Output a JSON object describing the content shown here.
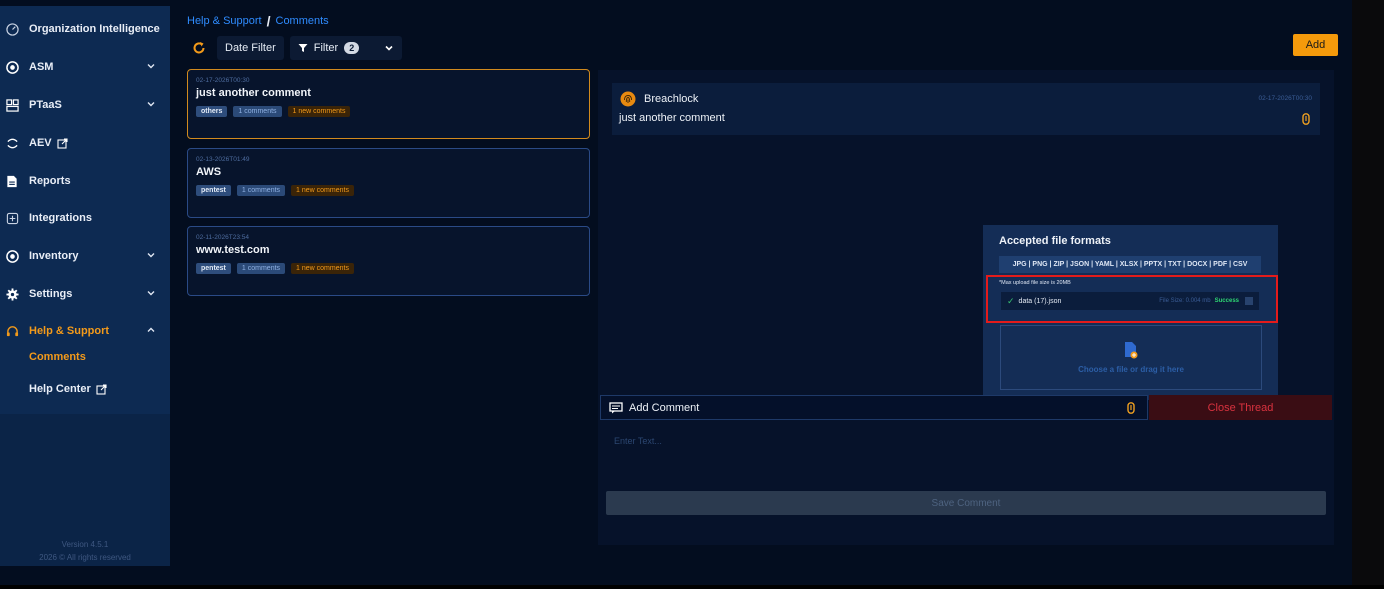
{
  "sidebar": {
    "items": [
      {
        "label": "Organization Intelligence",
        "icon": "gauge-icon"
      },
      {
        "label": "ASM",
        "icon": "target-icon"
      },
      {
        "label": "PTaaS",
        "icon": "dashboard-icon"
      },
      {
        "label": "AEV",
        "icon": "loop-icon"
      },
      {
        "label": "Reports",
        "icon": "document-icon"
      },
      {
        "label": "Integrations",
        "icon": "plug-icon"
      },
      {
        "label": "Inventory",
        "icon": "target-icon"
      },
      {
        "label": "Settings",
        "icon": "gear-icon"
      },
      {
        "label": "Help & Support",
        "icon": "headset-icon"
      }
    ],
    "sub_items": [
      {
        "label": "Comments"
      },
      {
        "label": "Help Center"
      }
    ],
    "version": "Version 4.5.1",
    "copyright": "2026 © All rights reserved"
  },
  "breadcrumb": {
    "parent": "Help & Support",
    "separator": "/",
    "current": "Comments"
  },
  "toolbar": {
    "date_filter": "Date Filter",
    "filter": "Filter",
    "filter_count": "2",
    "add": "Add"
  },
  "threads": [
    {
      "timestamp": "02-17-2026T00:30",
      "title": "just another comment",
      "category": "others",
      "comments": "1 comments",
      "new_comments": "1 new comments"
    },
    {
      "timestamp": "02-13-2026T01:49",
      "title": "AWS",
      "category": "pentest",
      "comments": "1 comments",
      "new_comments": "1 new comments"
    },
    {
      "timestamp": "02-11-2026T23:54",
      "title": "www.test.com",
      "category": "pentest",
      "comments": "1 comments",
      "new_comments": "1 new comments"
    }
  ],
  "message": {
    "author": "Breachlock",
    "timestamp": "02-17-2026T00:30",
    "body": "just another comment"
  },
  "upload": {
    "header": "Accepted file formats",
    "formats": "JPG | PNG | ZIP | JSON | YAML | XLSX | PPTX | TXT | DOCX | PDF | CSV",
    "max_size": "*Max upload file size is 20MB",
    "file": {
      "name": "data (17).json",
      "size": "File Size: 0.004 mb",
      "status": "Success"
    },
    "dropzone_text": "Choose a file or drag it here"
  },
  "comment": {
    "label": "Add Comment",
    "close_thread": "Close Thread",
    "placeholder": "Enter Text...",
    "save": "Save Comment"
  },
  "colors": {
    "accent": "#f59a0b",
    "link": "#2f8cff",
    "sidebar": "#0d2a52",
    "danger": "#d8323f",
    "success": "#2ed573",
    "highlight": "#e41b1b"
  }
}
